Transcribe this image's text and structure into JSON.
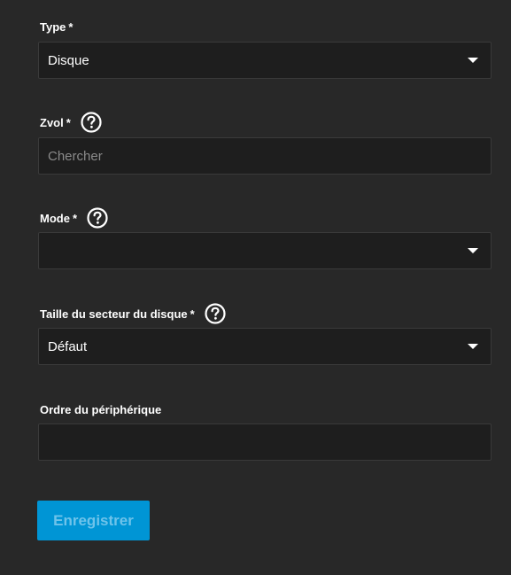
{
  "form": {
    "type": {
      "label": "Type",
      "required": "*",
      "value": "Disque"
    },
    "zvol": {
      "label": "Zvol",
      "required": "*",
      "placeholder": "Chercher",
      "help_icon": "question-circle-icon"
    },
    "mode": {
      "label": "Mode",
      "required": "*",
      "value": "",
      "help_icon": "question-circle-icon"
    },
    "sector_size": {
      "label": "Taille du secteur du disque",
      "required": "*",
      "value": "Défaut",
      "help_icon": "question-circle-icon"
    },
    "device_order": {
      "label": "Ordre du périphérique",
      "value": ""
    },
    "submit_label": "Enregistrer"
  },
  "colors": {
    "background": "#282828",
    "field_background": "#1e1e1e",
    "accent": "#0095d5"
  }
}
